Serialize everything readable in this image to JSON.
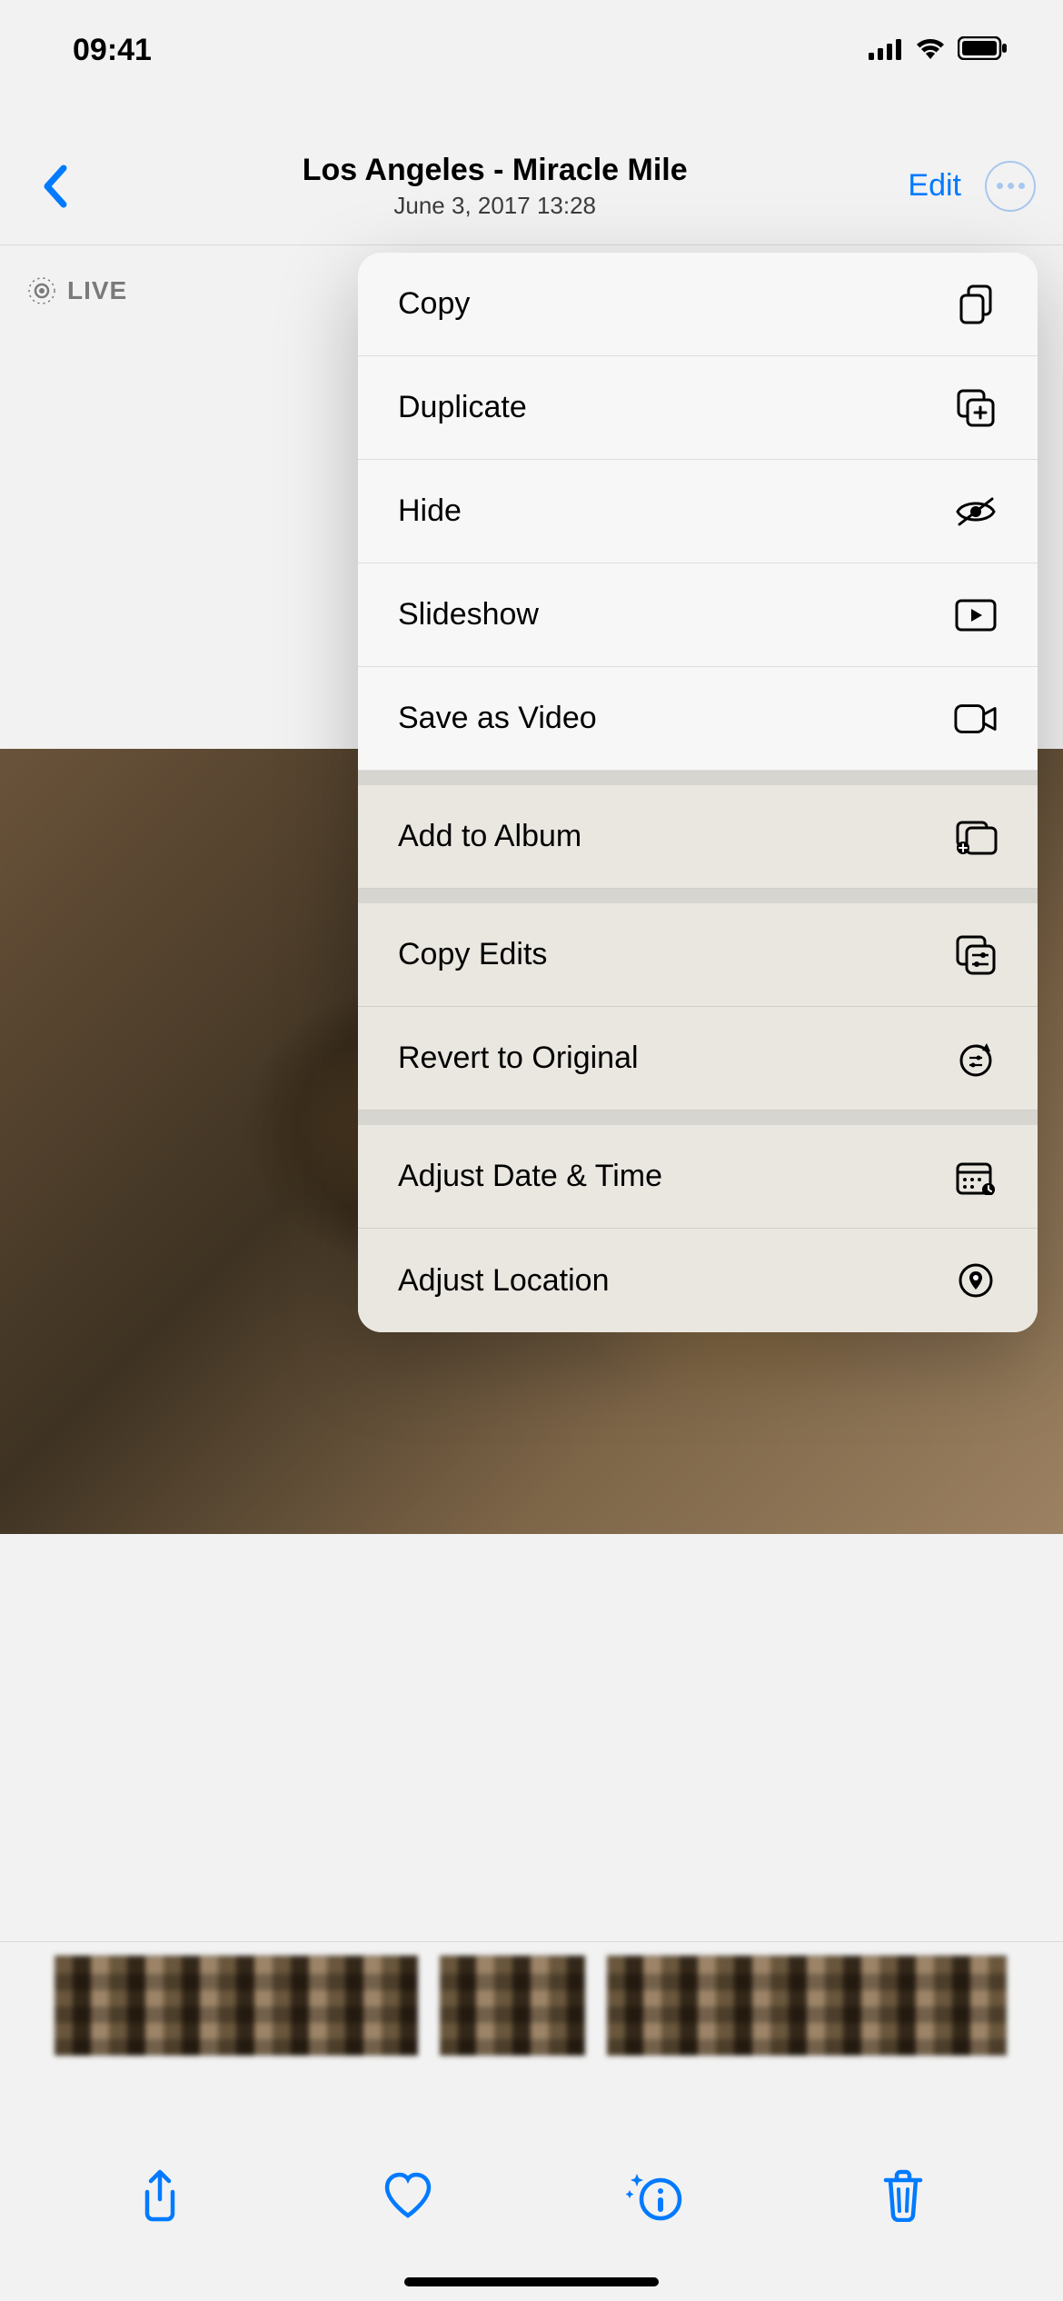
{
  "status": {
    "time": "09:41"
  },
  "nav": {
    "title": "Los Angeles - Miracle Mile",
    "subtitle": "June 3, 2017  13:28",
    "edit": "Edit"
  },
  "live_badge": "LIVE",
  "menu": {
    "copy": "Copy",
    "duplicate": "Duplicate",
    "hide": "Hide",
    "slideshow": "Slideshow",
    "save_as_video": "Save as Video",
    "add_to_album": "Add to Album",
    "copy_edits": "Copy Edits",
    "revert": "Revert to Original",
    "adjust_date": "Adjust Date & Time",
    "adjust_location": "Adjust Location"
  }
}
